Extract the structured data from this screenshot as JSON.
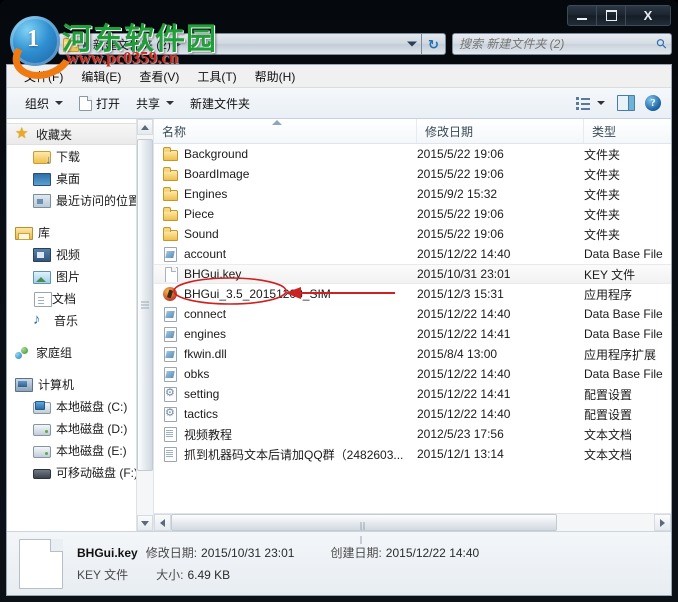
{
  "window": {
    "controls": {
      "minimize_label": "–",
      "maximize_label": "",
      "close_label": "X"
    }
  },
  "address_bar": {
    "path_text": "新建文件夹 (2)",
    "folder_icon": "folder-icon",
    "dropdown_icon": "chevron-down-icon",
    "refresh_icon": "refresh-icon",
    "refresh_glyph": "↻"
  },
  "search": {
    "placeholder": "搜索 新建文件夹 (2)",
    "value": "",
    "icon": "search-icon",
    "glyph": "⚲"
  },
  "menubar": {
    "items": [
      {
        "label": "文件(F)"
      },
      {
        "label": "编辑(E)"
      },
      {
        "label": "查看(V)"
      },
      {
        "label": "工具(T)"
      },
      {
        "label": "帮助(H)"
      }
    ]
  },
  "toolbar": {
    "organize_label": "组织",
    "open_label": "打开",
    "share_label": "共享",
    "new_folder_label": "新建文件夹",
    "view_options_icon": "view-options-icon",
    "preview_pane_icon": "preview-pane-icon",
    "help_icon": "help-icon",
    "help_glyph": "?"
  },
  "nav_pane": {
    "groups": [
      {
        "root": {
          "label": "收藏夹",
          "icon": "star-icon",
          "selected": true
        },
        "children": [
          {
            "label": "下载",
            "icon": "download-folder-icon"
          },
          {
            "label": "桌面",
            "icon": "desktop-icon"
          },
          {
            "label": "最近访问的位置",
            "icon": "recent-places-icon"
          }
        ]
      },
      {
        "root": {
          "label": "库",
          "icon": "library-icon",
          "selected": false
        },
        "children": [
          {
            "label": "视频",
            "icon": "video-icon"
          },
          {
            "label": "图片",
            "icon": "pictures-icon"
          },
          {
            "label": "文档",
            "icon": "documents-icon"
          },
          {
            "label": "音乐",
            "icon": "music-icon"
          }
        ]
      },
      {
        "root": {
          "label": "家庭组",
          "icon": "homegroup-icon",
          "selected": false
        },
        "children": []
      },
      {
        "root": {
          "label": "计算机",
          "icon": "computer-icon",
          "selected": false
        },
        "children": [
          {
            "label": "本地磁盘 (C:)",
            "icon": "system-drive-icon"
          },
          {
            "label": "本地磁盘 (D:)",
            "icon": "drive-icon"
          },
          {
            "label": "本地磁盘 (E:)",
            "icon": "drive-icon"
          },
          {
            "label": "可移动磁盘 (F:)",
            "icon": "removable-drive-icon"
          }
        ]
      }
    ]
  },
  "file_list": {
    "columns": [
      {
        "key": "name",
        "label": "名称",
        "sorted": "asc"
      },
      {
        "key": "date",
        "label": "修改日期",
        "sorted": ""
      },
      {
        "key": "type",
        "label": "类型",
        "sorted": ""
      }
    ],
    "rows": [
      {
        "name": "Background",
        "date": "2015/5/22 19:06",
        "type": "文件夹",
        "icon": "folder-icon",
        "selected": false
      },
      {
        "name": "BoardImage",
        "date": "2015/5/22 19:06",
        "type": "文件夹",
        "icon": "folder-icon",
        "selected": false
      },
      {
        "name": "Engines",
        "date": "2015/9/2 15:32",
        "type": "文件夹",
        "icon": "folder-icon",
        "selected": false
      },
      {
        "name": "Piece",
        "date": "2015/5/22 19:06",
        "type": "文件夹",
        "icon": "folder-icon",
        "selected": false
      },
      {
        "name": "Sound",
        "date": "2015/5/22 19:06",
        "type": "文件夹",
        "icon": "folder-icon",
        "selected": false
      },
      {
        "name": "account",
        "date": "2015/12/22 14:40",
        "type": "Data Base File",
        "icon": "database-file-icon",
        "selected": false
      },
      {
        "name": "BHGui.key",
        "date": "2015/10/31 23:01",
        "type": "KEY 文件",
        "icon": "key-file-icon",
        "selected": true
      },
      {
        "name": "BHGui_3.5_20151203_SIM",
        "date": "2015/12/3 15:31",
        "type": "应用程序",
        "icon": "application-icon",
        "selected": false
      },
      {
        "name": "connect",
        "date": "2015/12/22 14:40",
        "type": "Data Base File",
        "icon": "database-file-icon",
        "selected": false
      },
      {
        "name": "engines",
        "date": "2015/12/22 14:41",
        "type": "Data Base File",
        "icon": "database-file-icon",
        "selected": false
      },
      {
        "name": "fkwin.dll",
        "date": "2015/8/4 13:00",
        "type": "应用程序扩展",
        "icon": "database-file-icon",
        "selected": false
      },
      {
        "name": "obks",
        "date": "2015/12/22 14:40",
        "type": "Data Base File",
        "icon": "database-file-icon",
        "selected": false
      },
      {
        "name": "setting",
        "date": "2015/12/22 14:41",
        "type": "配置设置",
        "icon": "config-file-icon",
        "selected": false
      },
      {
        "name": "tactics",
        "date": "2015/12/22 14:40",
        "type": "配置设置",
        "icon": "config-file-icon",
        "selected": false
      },
      {
        "name": "视频教程",
        "date": "2012/5/23 17:56",
        "type": "文本文档",
        "icon": "text-file-icon",
        "selected": false
      },
      {
        "name": "抓到机器码文本后请加QQ群（2482603...",
        "date": "2015/12/1 13:14",
        "type": "文本文档",
        "icon": "text-file-icon",
        "selected": false
      }
    ]
  },
  "details_pane": {
    "file_name": "BHGui.key",
    "modified_label": "修改日期:",
    "modified_value": "2015/10/31 23:01",
    "created_label": "创建日期:",
    "created_value": "2015/12/22 14:40",
    "file_type": "KEY 文件",
    "size_label": "大小:",
    "size_value": "6.49 KB",
    "icon": "key-file-large-icon"
  },
  "watermark": {
    "site_name": "河东软件园",
    "url": "www.pc0359.cn",
    "logo_digit": "1"
  },
  "annotation": {
    "shape": "red-ellipse-with-arrow",
    "target": "BHGui.key",
    "color": "#cc2222"
  },
  "colors": {
    "accent": "#1f6fb5",
    "watermark_green": "#1f9e3a",
    "watermark_red": "#d42a1d",
    "annotation_red": "#cc2222",
    "titlebar": "#0a0f16"
  }
}
